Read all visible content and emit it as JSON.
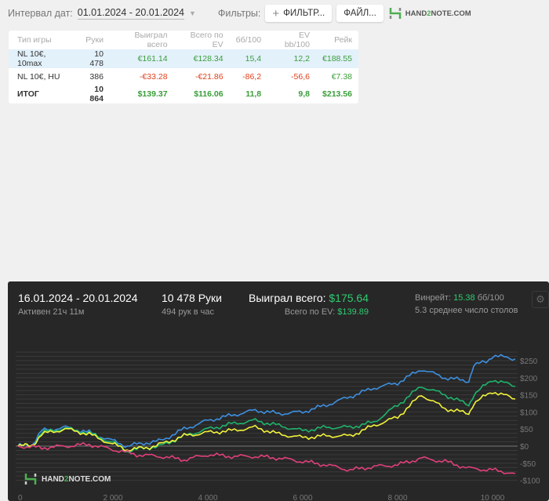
{
  "topbar": {
    "date_label": "Интервал дат:",
    "date_value": "01.01.2024 - 20.01.2024",
    "filters_label": "Фильтры:",
    "filter_button": "ФИЛЬТР...",
    "file_button": "ФАЙЛ...",
    "logo": "HAND2NOTE.COM"
  },
  "table": {
    "headers": [
      "Тип игры",
      "Руки",
      "Выиграл всего",
      "Всего по EV",
      "бб/100",
      "EV bb/100",
      "Рейк"
    ],
    "rows": [
      [
        "NL 10€, 10max",
        "10 478",
        "€161.14",
        "€128.34",
        "15,4",
        "12,2",
        "€188.55"
      ],
      [
        "NL 10€, HU",
        "386",
        "-€33.28",
        "-€21.86",
        "-86,2",
        "-56,6",
        "€7.38"
      ],
      [
        "ИТОГ",
        "10 864",
        "$139.37",
        "$116.06",
        "11,8",
        "9,8",
        "$213.56"
      ]
    ]
  },
  "panel": {
    "dates": "16.01.2024 - 20.01.2024",
    "active": "Активен 21ч 11м",
    "hands": "10 478 Руки",
    "hands_per_hour": "494 рук в час",
    "won_label": "Выиграл всего:",
    "won_value": "$175.64",
    "ev_label": "Всего по EV:",
    "ev_value": "$139.89",
    "winrate_label": "Винрейт:",
    "winrate_value": "15.38",
    "winrate_unit": "бб/100",
    "tables": "5.3 среднее число столов",
    "logo": "HAND2NOTE.COM"
  },
  "chart_data": {
    "type": "line",
    "xlim": [
      0,
      10478
    ],
    "ylim": [
      -100,
      275
    ],
    "x_ticks": [
      {
        "v": 0,
        "l": "0"
      },
      {
        "v": 2000,
        "l": "2 000"
      },
      {
        "v": 4000,
        "l": "4 000"
      },
      {
        "v": 6000,
        "l": "6 000"
      },
      {
        "v": 8000,
        "l": "8 000"
      },
      {
        "v": 10000,
        "l": "10 000"
      }
    ],
    "y_ticks": [
      {
        "v": 250,
        "l": "$250"
      },
      {
        "v": 200,
        "l": "$200"
      },
      {
        "v": 150,
        "l": "$150"
      },
      {
        "v": 100,
        "l": "$100"
      },
      {
        "v": 50,
        "l": "$50"
      },
      {
        "v": 0,
        "l": "$0"
      },
      {
        "v": -50,
        "l": "-$50"
      },
      {
        "v": -100,
        "l": "-$100"
      }
    ],
    "series": [
      {
        "name": "blue",
        "color": "#3d8fe0",
        "x": [
          0,
          300,
          500,
          1000,
          1500,
          2000,
          2300,
          2700,
          3000,
          3500,
          4000,
          4500,
          5000,
          5500,
          6000,
          6500,
          7000,
          7500,
          8000,
          8500,
          9000,
          9500,
          9600,
          9900,
          10000,
          10478
        ],
        "y": [
          0,
          5,
          45,
          55,
          40,
          15,
          0,
          10,
          15,
          50,
          75,
          90,
          105,
          95,
          100,
          120,
          145,
          170,
          185,
          225,
          200,
          190,
          235,
          250,
          265,
          255
        ]
      },
      {
        "name": "green",
        "color": "#1fb36b",
        "x": [
          0,
          300,
          500,
          1000,
          1500,
          2000,
          2300,
          2700,
          3000,
          3500,
          4000,
          4500,
          5000,
          5500,
          6000,
          6500,
          7000,
          7500,
          8000,
          8500,
          9000,
          9500,
          9600,
          10000,
          10478
        ],
        "y": [
          0,
          2,
          40,
          52,
          38,
          10,
          -15,
          -5,
          0,
          30,
          50,
          65,
          75,
          60,
          45,
          55,
          55,
          70,
          120,
          175,
          150,
          120,
          150,
          195,
          175
        ]
      },
      {
        "name": "yellow",
        "color": "#f2f23a",
        "x": [
          0,
          300,
          500,
          1000,
          1500,
          2000,
          2300,
          2700,
          3000,
          3500,
          4000,
          4500,
          5000,
          5500,
          6000,
          6500,
          7000,
          7500,
          8000,
          8500,
          9000,
          9500,
          9600,
          10000,
          10478
        ],
        "y": [
          0,
          2,
          35,
          50,
          35,
          5,
          -10,
          -5,
          5,
          30,
          40,
          45,
          55,
          35,
          25,
          30,
          30,
          60,
          85,
          150,
          110,
          95,
          125,
          160,
          138
        ]
      },
      {
        "name": "pink",
        "color": "#e0407a",
        "x": [
          0,
          500,
          1000,
          1500,
          2000,
          2500,
          3000,
          3500,
          4000,
          4500,
          5000,
          5500,
          6000,
          6500,
          7000,
          7500,
          8000,
          8500,
          9000,
          9500,
          10000,
          10478
        ],
        "y": [
          0,
          -5,
          0,
          5,
          -10,
          -25,
          -30,
          -40,
          -25,
          -30,
          -30,
          -35,
          -45,
          -55,
          -70,
          -60,
          -55,
          -35,
          -45,
          -65,
          -70,
          -80
        ]
      }
    ]
  }
}
